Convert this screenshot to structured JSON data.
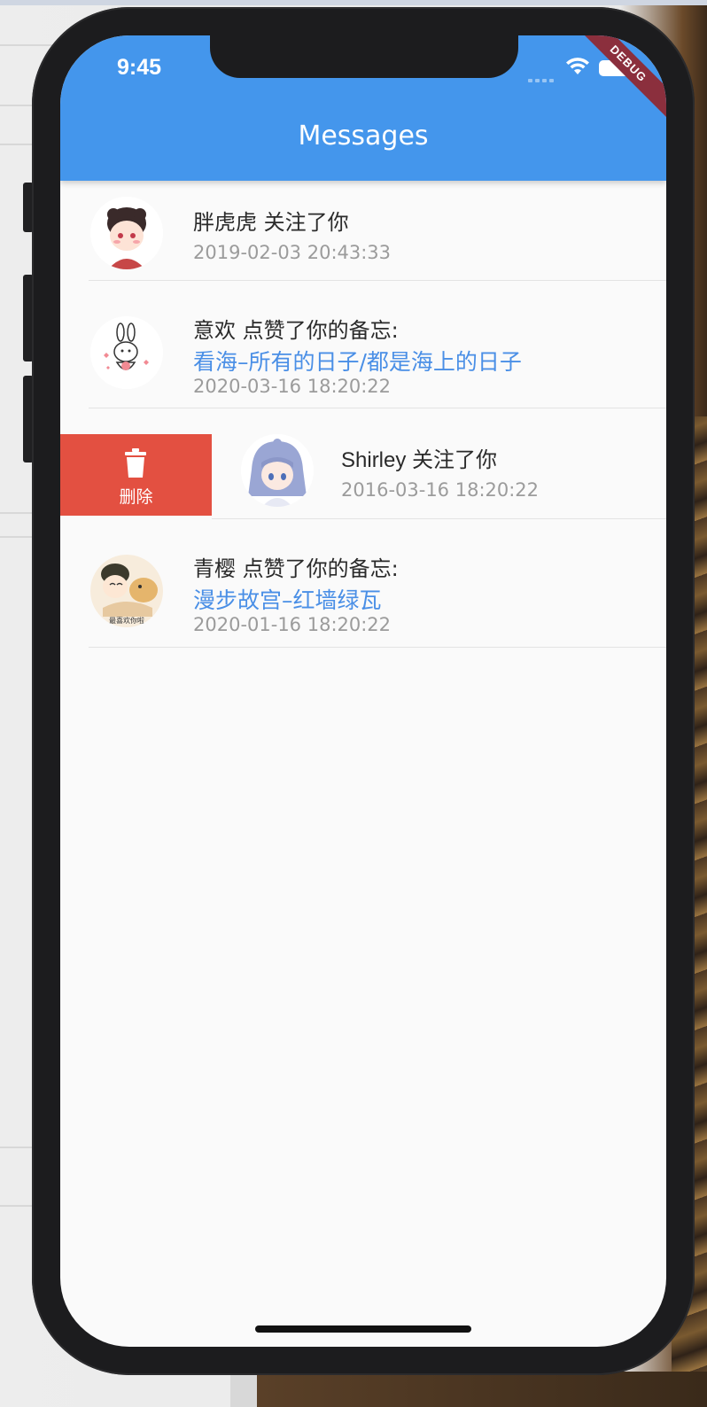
{
  "status_bar": {
    "time": "9:45",
    "debug_banner": "DEBUG"
  },
  "app_bar": {
    "title": "Messages"
  },
  "messages": [
    {
      "text": "胖虎虎 关注了你",
      "time": "2019-02-03 20:43:33"
    },
    {
      "text": "意欢 点赞了你的备忘:",
      "link": "看海–所有的日子/都是海上的日子",
      "time": "2020-03-16 18:20:22"
    },
    {
      "text": "Shirley 关注了你",
      "time": "2016-03-16 18:20:22"
    },
    {
      "text": "青樱 点赞了你的备忘:",
      "link": "漫步故宫–红墙绿瓦",
      "time": "2020-01-16 18:20:22",
      "avatar_caption": "最喜欢你啦"
    }
  ],
  "swipe_action": {
    "label": "删除",
    "icon": "trash-icon",
    "color": "#e35041"
  },
  "colors": {
    "app_bar": "#4496ec",
    "link": "#4a8fe6",
    "timestamp": "#9b9b9b"
  }
}
